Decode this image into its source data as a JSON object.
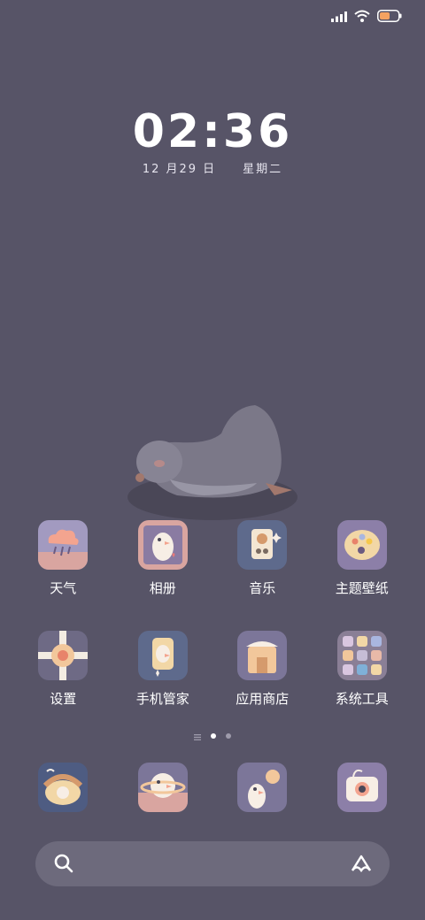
{
  "status": {
    "battery_level": 0.55
  },
  "clock": {
    "time": "02:36",
    "date": "12 月29 日",
    "weekday": "星期二"
  },
  "apps": [
    {
      "label": "天气",
      "icon": "weather-icon"
    },
    {
      "label": "相册",
      "icon": "gallery-icon"
    },
    {
      "label": "音乐",
      "icon": "music-icon"
    },
    {
      "label": "主题壁纸",
      "icon": "themes-icon"
    },
    {
      "label": "设置",
      "icon": "settings-icon"
    },
    {
      "label": "手机管家",
      "icon": "security-icon"
    },
    {
      "label": "应用商店",
      "icon": "app-store-icon"
    },
    {
      "label": "系统工具",
      "icon": "system-tools-folder-icon"
    }
  ],
  "dock": [
    {
      "icon": "phone-icon"
    },
    {
      "icon": "browser-icon"
    },
    {
      "icon": "messages-icon"
    },
    {
      "icon": "camera-icon"
    }
  ],
  "page_indicator": {
    "pages": 2,
    "current": 1
  },
  "colors": {
    "background": "#575467",
    "search_bar": "#6d6a7c",
    "battery": "#f4a261"
  }
}
